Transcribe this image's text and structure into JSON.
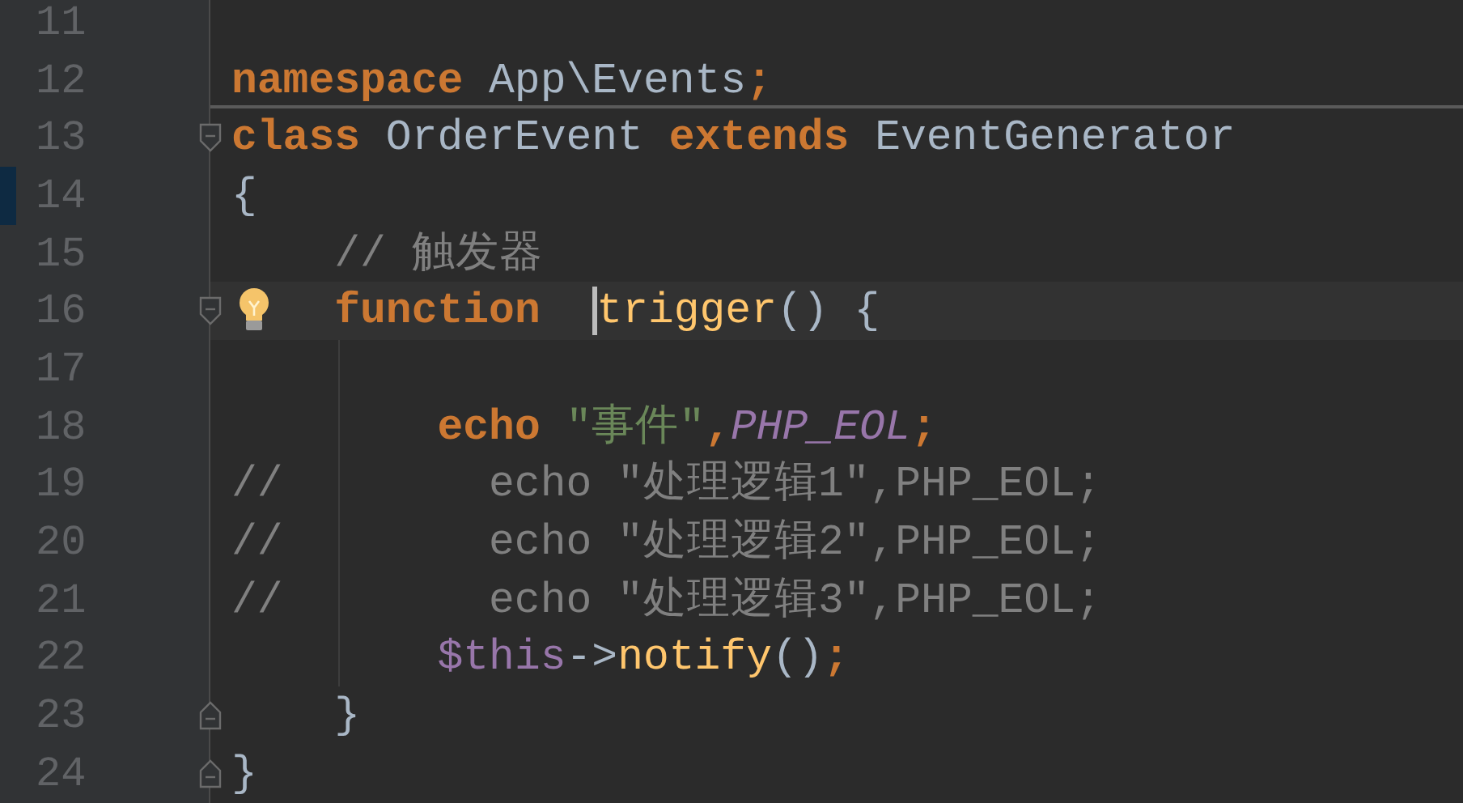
{
  "editor": {
    "lines": [
      {
        "number": "11"
      },
      {
        "number": "12",
        "separator": true,
        "tokens": [
          {
            "kind": "keyword",
            "text": "namespace"
          },
          {
            "kind": "plain",
            "text": " App\\Events"
          },
          {
            "kind": "keyword",
            "text": ";"
          }
        ]
      },
      {
        "number": "13",
        "fold_start": true,
        "tokens": [
          {
            "kind": "keyword",
            "text": "class"
          },
          {
            "kind": "plain",
            "text": " OrderEvent "
          },
          {
            "kind": "keyword",
            "text": "extends"
          },
          {
            "kind": "plain",
            "text": " EventGenerator"
          }
        ]
      },
      {
        "number": "14",
        "marked": true,
        "tokens": [
          {
            "kind": "plain",
            "text": "{"
          }
        ]
      },
      {
        "number": "15",
        "tokens": [
          {
            "kind": "comment",
            "text": "    // 触发器"
          }
        ]
      },
      {
        "number": "16",
        "current": true,
        "bulb": true,
        "fold_start": true,
        "tokens": [
          {
            "kind": "keyword",
            "text": "    function  "
          },
          {
            "kind": "caret"
          },
          {
            "kind": "function",
            "text": "trigger"
          },
          {
            "kind": "plain",
            "text": "() {"
          }
        ]
      },
      {
        "number": "17",
        "guide": true
      },
      {
        "number": "18",
        "guide": true,
        "tokens": [
          {
            "kind": "keyword",
            "text": "        echo"
          },
          {
            "kind": "string",
            "text": " \"事件\""
          },
          {
            "kind": "keyword",
            "text": ","
          },
          {
            "kind": "constant",
            "text": "PHP_EOL"
          },
          {
            "kind": "keyword",
            "text": ";"
          }
        ]
      },
      {
        "number": "19",
        "guide": true,
        "tokens": [
          {
            "kind": "comment",
            "text": "//        echo \"处理逻辑1\",PHP_EOL;"
          }
        ]
      },
      {
        "number": "20",
        "guide": true,
        "tokens": [
          {
            "kind": "comment",
            "text": "//        echo \"处理逻辑2\",PHP_EOL;"
          }
        ]
      },
      {
        "number": "21",
        "guide": true,
        "tokens": [
          {
            "kind": "comment",
            "text": "//        echo \"处理逻辑3\",PHP_EOL;"
          }
        ]
      },
      {
        "number": "22",
        "guide": true,
        "tokens": [
          {
            "kind": "variable",
            "text": "        $this"
          },
          {
            "kind": "plain",
            "text": "->"
          },
          {
            "kind": "function",
            "text": "notify"
          },
          {
            "kind": "plain",
            "text": "()"
          },
          {
            "kind": "keyword",
            "text": ";"
          }
        ]
      },
      {
        "number": "23",
        "fold_end": true,
        "tokens": [
          {
            "kind": "plain",
            "text": "    }"
          }
        ]
      },
      {
        "number": "24",
        "fold_end": true,
        "tokens": [
          {
            "kind": "plain",
            "text": "}"
          }
        ]
      }
    ]
  }
}
